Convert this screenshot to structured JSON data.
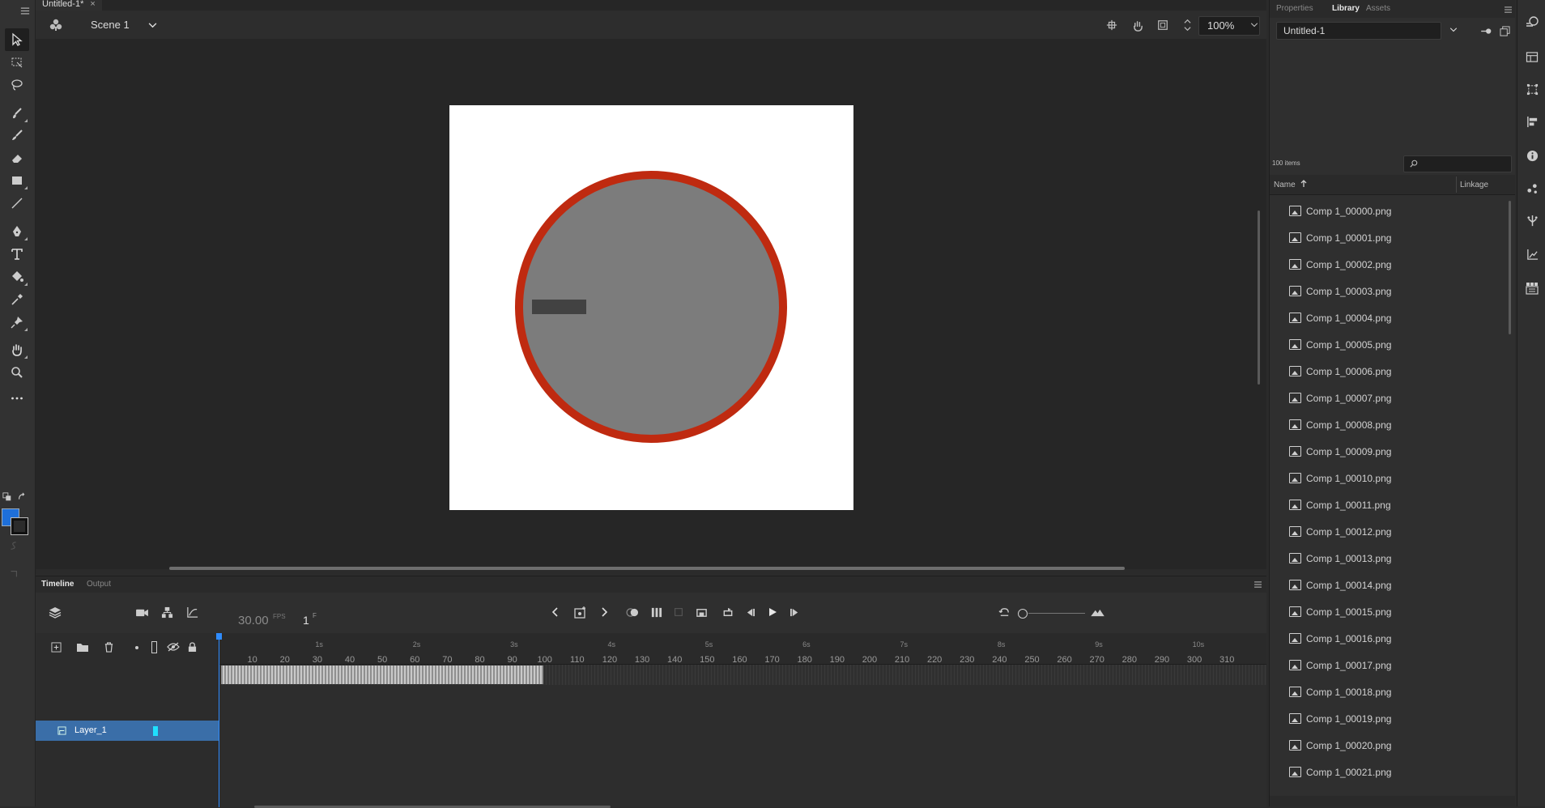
{
  "document": {
    "tab_title": "Untitled-1*",
    "close_glyph": "×"
  },
  "edit_bar": {
    "scene_label": "Scene 1",
    "zoom_value": "100%"
  },
  "stage": {
    "background": "#ffffff",
    "circle_fill": "#7c7c7c",
    "circle_stroke": "#bf2a10",
    "bar_fill": "#424242"
  },
  "timeline": {
    "tabs": [
      "Timeline",
      "Output"
    ],
    "fps_value": "30.00",
    "fps_unit": "FPS",
    "current_frame": "1",
    "frame_unit": "F",
    "seconds_markers": [
      "1s",
      "2s",
      "3s",
      "4s",
      "5s",
      "6s",
      "7s",
      "8s",
      "9s",
      "10s"
    ],
    "frame_numbers": [
      "10",
      "20",
      "30",
      "40",
      "50",
      "60",
      "70",
      "80",
      "90",
      "100",
      "110",
      "120",
      "130",
      "140",
      "150",
      "160",
      "170",
      "180",
      "190",
      "200",
      "210",
      "220",
      "230",
      "240",
      "250",
      "260",
      "270",
      "280",
      "290",
      "300",
      "310"
    ],
    "layer_name": "Layer_1",
    "layer_color": "#1fe0ff"
  },
  "right_panel": {
    "tabs": [
      "Properties",
      "Library",
      "Assets"
    ],
    "active_tab": "Library",
    "library_document": "Untitled-1",
    "item_count": "100 items",
    "column_name": "Name",
    "column_linkage": "Linkage",
    "items": [
      "Comp 1_00000.png",
      "Comp 1_00001.png",
      "Comp 1_00002.png",
      "Comp 1_00003.png",
      "Comp 1_00004.png",
      "Comp 1_00005.png",
      "Comp 1_00006.png",
      "Comp 1_00007.png",
      "Comp 1_00008.png",
      "Comp 1_00009.png",
      "Comp 1_00010.png",
      "Comp 1_00011.png",
      "Comp 1_00012.png",
      "Comp 1_00013.png",
      "Comp 1_00014.png",
      "Comp 1_00015.png",
      "Comp 1_00016.png",
      "Comp 1_00017.png",
      "Comp 1_00018.png",
      "Comp 1_00019.png",
      "Comp 1_00020.png",
      "Comp 1_00021.png"
    ]
  },
  "colors": {
    "accent": "#2f8cff",
    "selected_layer": "#3a6ea8",
    "fill_swatch": "#1e6fd9"
  }
}
